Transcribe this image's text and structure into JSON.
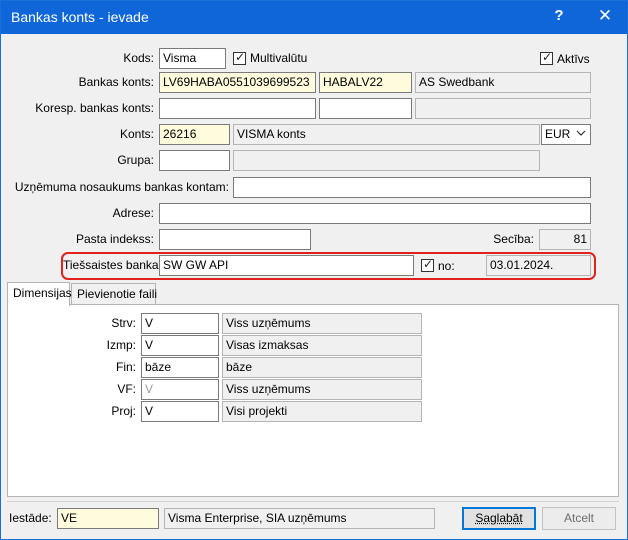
{
  "window": {
    "title": "Bankas konts - ievade",
    "help_symbol": "?",
    "close_symbol": "✕"
  },
  "form": {
    "kods": {
      "label": "Kods:",
      "value": "Visma"
    },
    "multivaluta": {
      "label": "Multivalūtu",
      "checked": true
    },
    "aktivs": {
      "label": "Aktīvs",
      "checked": true
    },
    "bankas_konts": {
      "label": "Bankas konts:",
      "account": "LV69HABA0551039699523",
      "bic": "HABALV22",
      "bank_name": "AS Swedbank"
    },
    "koresp": {
      "label": "Koresp. bankas konts:",
      "account": "",
      "bic": "",
      "bank_name": ""
    },
    "konts": {
      "label": "Konts:",
      "code": "26216",
      "name": "VISMA konts",
      "currency": "EUR"
    },
    "grupa": {
      "label": "Grupa:",
      "code": "",
      "name": ""
    },
    "nosaukums": {
      "label": "Uzņēmuma nosaukums bankas kontam:",
      "value": ""
    },
    "adrese": {
      "label": "Adrese:",
      "value": ""
    },
    "pasta": {
      "label": "Pasta indekss:",
      "value": ""
    },
    "seciba": {
      "label": "Secība:",
      "value": "81"
    },
    "tiessaistes": {
      "label": "Tiešsaistes banka:",
      "value": "SW GW API",
      "no_label": "no:",
      "no_checked": true,
      "date": "03.01.2024."
    }
  },
  "tabs": [
    {
      "label": "Dimensijas",
      "active": true
    },
    {
      "label": "Pievienotie faili",
      "active": false
    }
  ],
  "dimensions": [
    {
      "label": "Strv:",
      "code": "V",
      "name": "Viss uzņēmums"
    },
    {
      "label": "Izmp:",
      "code": "V",
      "name": "Visas izmaksas"
    },
    {
      "label": "Fin:",
      "code": "bāze",
      "name": "bāze"
    },
    {
      "label": "VF:",
      "code": "V",
      "name": "Viss uzņēmums"
    },
    {
      "label": "Proj:",
      "code": "V",
      "name": "Visi projekti"
    }
  ],
  "footer": {
    "iestade_label": "Iestāde:",
    "iestade_code": "VE",
    "iestade_name": "Visma Enterprise, SIA uzņēmums",
    "save_label": "Saglabāt",
    "cancel_label": "Atcelt"
  }
}
